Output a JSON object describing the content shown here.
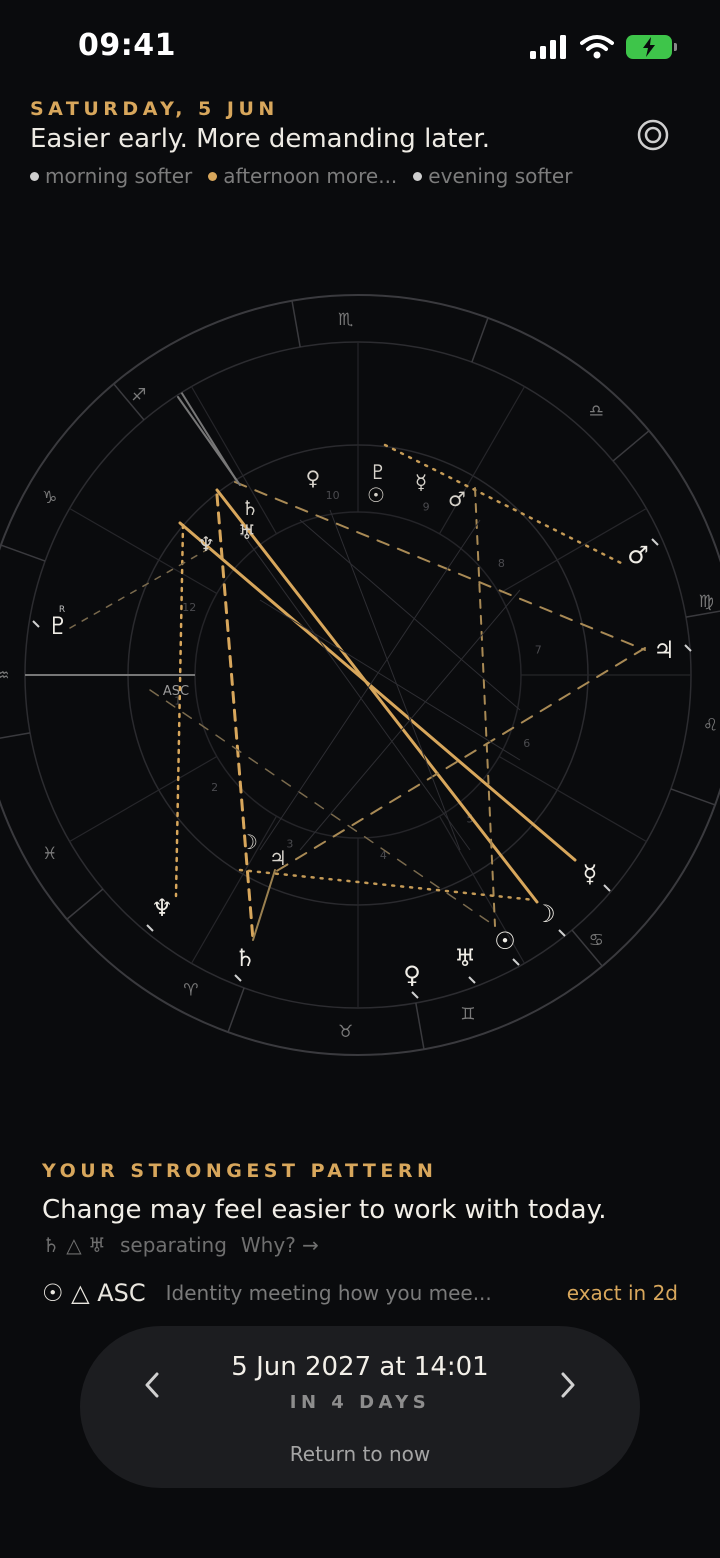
{
  "status_bar": {
    "time": "09:41",
    "icons": [
      "cellular-signal-icon",
      "wifi-icon",
      "battery-charging-icon"
    ],
    "battery_color": "#3ec54a"
  },
  "header": {
    "date": "SATURDAY, 5 JUN",
    "headline": "Easier early. More demanding later.",
    "phases": [
      {
        "label": "morning softer",
        "color": "#cfcfcf"
      },
      {
        "label": "afternoon more...",
        "color": "#d8a75c"
      },
      {
        "label": "evening softer",
        "color": "#cfcfcf"
      }
    ],
    "target_icon": "target-icon"
  },
  "chart": {
    "signs": [
      "♈",
      "♉",
      "♊",
      "♋",
      "♌",
      "♍",
      "♎",
      "♏",
      "♐",
      "♑",
      "♒",
      "♓"
    ],
    "house_numbers": [
      "1",
      "2",
      "3",
      "4",
      "5",
      "6",
      "7",
      "8",
      "9",
      "10",
      "11",
      "12"
    ],
    "asc_label": "ASC",
    "inner_planets": [
      {
        "glyph": "♄",
        "retro": ""
      },
      {
        "glyph": "♆",
        "retro": ""
      },
      {
        "glyph": "♅",
        "retro": ""
      },
      {
        "glyph": "♀",
        "retro": ""
      },
      {
        "glyph": "♇",
        "retro": ""
      },
      {
        "glyph": "☉",
        "retro": ""
      },
      {
        "glyph": "☿",
        "retro": ""
      },
      {
        "glyph": "♂",
        "retro": ""
      },
      {
        "glyph": "☽",
        "retro": ""
      },
      {
        "glyph": "♃",
        "retro": ""
      }
    ],
    "outer_planets": [
      {
        "glyph": "♂",
        "retro": ""
      },
      {
        "glyph": "♃",
        "retro": ""
      },
      {
        "glyph": "♇",
        "retro": "R"
      },
      {
        "glyph": "☿",
        "retro": ""
      },
      {
        "glyph": "☽",
        "retro": ""
      },
      {
        "glyph": "☉",
        "retro": ""
      },
      {
        "glyph": "♅",
        "retro": ""
      },
      {
        "glyph": "♀",
        "retro": ""
      },
      {
        "glyph": "♄",
        "retro": ""
      },
      {
        "glyph": "♆",
        "retro": ""
      }
    ],
    "colors": {
      "accent": "#d8a75c",
      "ring": "#3a3a3e",
      "tick": "#cfcfcf"
    }
  },
  "pattern": {
    "kicker": "YOUR STRONGEST PATTERN",
    "title": "Change may feel easier to work with today.",
    "aspect_glyphs": "♄ △ ♅",
    "status": "separating",
    "why_label": "Why? →"
  },
  "aspect_row": {
    "symbol": "☉ △ ASC",
    "description": "Identity meeting how you mee...",
    "timing": "exact in 2d"
  },
  "time_control": {
    "date_label": "5 Jun 2027 at 14:01",
    "relative_label": "IN 4 DAYS",
    "return_label": "Return to now"
  }
}
